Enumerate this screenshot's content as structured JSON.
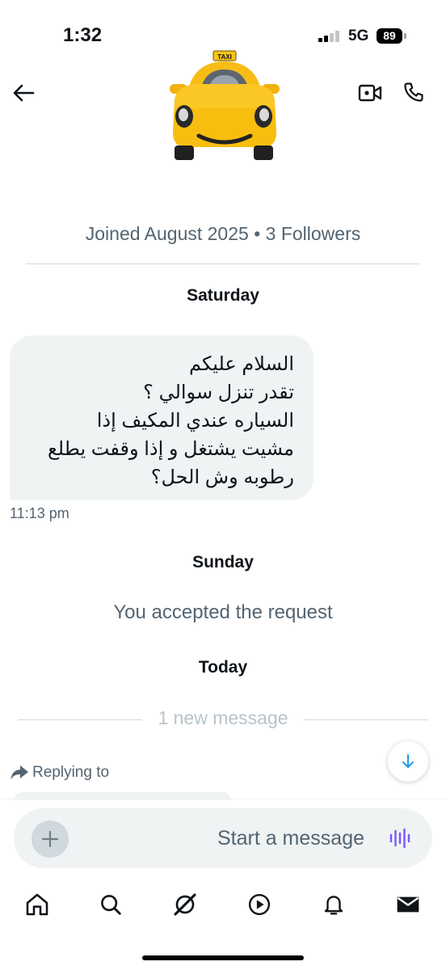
{
  "status_bar": {
    "time": "1:32",
    "network": "5G",
    "battery": "89"
  },
  "header": {
    "avatar_icon": "taxi-emoji",
    "back_icon": "arrow-left-icon",
    "video_icon": "video-call-icon",
    "call_icon": "phone-icon"
  },
  "profile": {
    "meta": "Joined August 2025 • 3 Followers"
  },
  "conversation": {
    "day_1": "Saturday",
    "message_1": {
      "lines": [
        "السلام عليكم",
        "تقدر تنزل سوالي ؟",
        "السياره عندي المكيف إذا",
        "مشيت يشتغل و إذا وقفت يطلع",
        "رطوبه وش الحل؟"
      ],
      "time": "11:13 pm"
    },
    "day_2": "Sunday",
    "system_message": "You accepted the request",
    "day_3": "Today",
    "new_message_divider": "1 new message",
    "replying_label": "Replying to"
  },
  "composer": {
    "placeholder": "Start a message"
  },
  "tabs": [
    "home-icon",
    "search-icon",
    "grok-icon",
    "video-play-icon",
    "bell-icon",
    "mail-icon"
  ],
  "colors": {
    "text": "#0f1419",
    "secondary": "#536471",
    "bubble": "#eff3f4",
    "accent": "#1d9bf0",
    "voice": "#7856ff"
  }
}
